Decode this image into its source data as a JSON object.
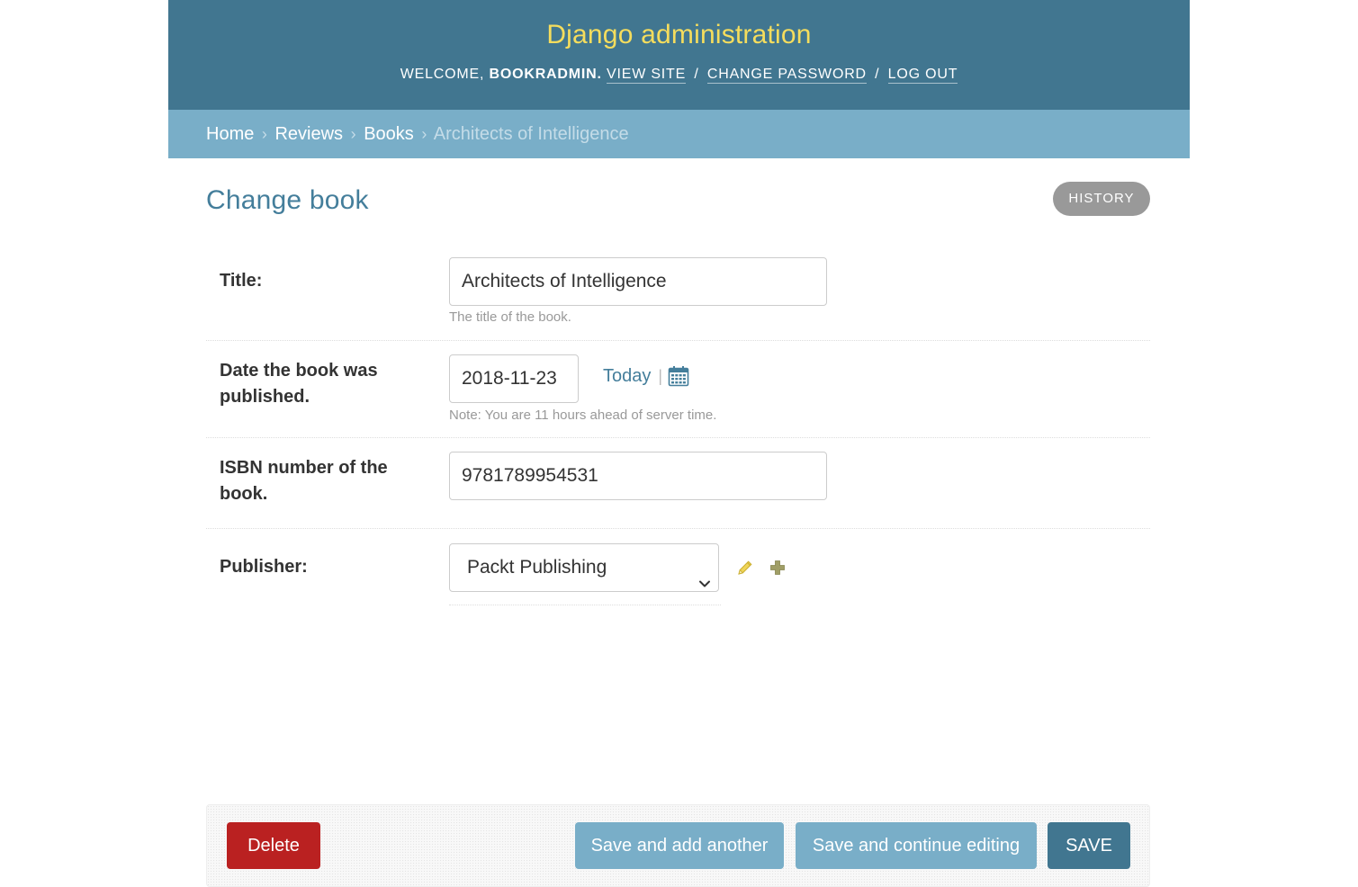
{
  "header": {
    "branding": "Django administration",
    "welcome": "WELCOME,",
    "username": "BOOKRADMIN.",
    "links": {
      "view_site": "VIEW SITE",
      "change_password": "CHANGE PASSWORD",
      "log_out": "LOG OUT"
    },
    "separator": "/"
  },
  "breadcrumbs": {
    "items": [
      "Home",
      "Reviews",
      "Books"
    ],
    "current": "Architects of Intelligence",
    "separator": "›"
  },
  "page": {
    "title": "Change book",
    "history_label": "HISTORY"
  },
  "form": {
    "title": {
      "label": "Title:",
      "value": "Architects of Intelligence",
      "help": "The title of the book."
    },
    "pub_date": {
      "label": "Date the book was published.",
      "value": "2018-11-23",
      "today_label": "Today",
      "pipe": "|",
      "help": "Note: You are 11 hours ahead of server time."
    },
    "isbn": {
      "label": "ISBN number of the book.",
      "value": "9781789954531"
    },
    "publisher": {
      "label": "Publisher:",
      "selected": "Packt Publishing"
    }
  },
  "actions": {
    "delete": "Delete",
    "save_add_another": "Save and add another",
    "save_continue": "Save and continue editing",
    "save": "SAVE"
  },
  "icons": {
    "calendar": "calendar-icon",
    "edit": "pencil-icon",
    "add": "plus-icon",
    "select": "chevron-down-icon"
  },
  "colors": {
    "header_bg": "#417690",
    "branding": "#f5dd5d",
    "breadcrumbs_bg": "#79aec8",
    "title": "#447e9b",
    "delete": "#ba2121",
    "secondary_button": "#79aec8",
    "primary_button": "#417690"
  }
}
